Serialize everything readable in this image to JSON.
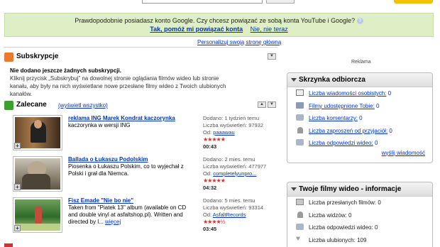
{
  "google_banner": {
    "question": "Prawdopodobnie posiadasz konto Google. Czy chcesz powiązać ze sobą konta YouTube i Google?",
    "help_icon": "question-icon",
    "yes_link": "Tak, pomóż mi powiązać konta",
    "no_link": "Nie, nie teraz"
  },
  "personalize_link": "Personalizuj swoją stronę główną",
  "subscriptions": {
    "title": "Subskrypcje",
    "empty_title": "Nie dodano jeszcze żadnych subskrypcji.",
    "empty_desc": "Kliknij przycisk „Subskrybuj” na dowolnej stronie oglądania filmów wideo lub stronie kanału, aby były na nich wyświetlane nowe przesłane filmy wideo z Twoich ulubionych kanałów.",
    "toggle_icon": "collapse-icon"
  },
  "featured": {
    "title": "Zalecane",
    "show_all": "(wyświetl wszystko)",
    "videos": [
      {
        "title": "reklama ING Marek Kondrat kaczorynka",
        "desc": "kaczorynka w wersji ING",
        "more": "",
        "added": "Dodano: 1 tydzień temu",
        "views": "Liczba wyświetleń: 97932",
        "from_label": "Od:",
        "from": "paaawau",
        "stars": "★★★★★",
        "duration": "00:43"
      },
      {
        "title": "Ballada o Łukaszu Podolskim",
        "desc": "Piosenka o Łukaszu Polskim, co to wyjechał z Polski i grał dla Niemca.",
        "more": "",
        "added": "Dodano: 2 mies. temu",
        "views": "Liczba wyświetleń: 477977",
        "from_label": "Od:",
        "from": "completelyunpro...",
        "stars": "★★★★★",
        "duration": "04:32"
      },
      {
        "title": "Fisz Emade \"Nie bo nie\"",
        "desc": "Taken from \"Piatek 13\" album (available on CD and double vinyl at asfaltshop.pl). Written and directed by l...",
        "more": "więcej",
        "added": "Dodano: 5 mies. temu",
        "views": "Liczba wyświetleń: 93314",
        "from_label": "Od:",
        "from": "AsfaltRecords",
        "stars": "★★★★½",
        "duration": "03:45"
      }
    ]
  },
  "ad_label": "Reklama",
  "inbox": {
    "title": "Skrzynka odbiorcza",
    "rows": [
      {
        "label": "Liczba wiadomości osobistych:",
        "value": "0",
        "icon": "envelope-icon"
      },
      {
        "label": "Filmy udostępnione Tobie:",
        "value": "0",
        "icon": "film-icon"
      },
      {
        "label": "Liczba komentarzy:",
        "value": "0",
        "icon": "comment-icon"
      },
      {
        "label": "Liczba zaproszeń od przyjaciół:",
        "value": "0",
        "icon": "person-icon"
      },
      {
        "label": "Liczba odpowiedzi wideo:",
        "value": "0",
        "icon": "video-reply-icon"
      }
    ],
    "more": "wyślij wiadomość"
  },
  "my_videos": {
    "title": "Twoje filmy wideo - informacje",
    "rows": [
      {
        "label": "Liczba przesłanych filmów:",
        "value": "0",
        "icon": "upload-icon"
      },
      {
        "label": "Liczba widzów:",
        "value": "0",
        "icon": "person-icon"
      },
      {
        "label": "Liczba odpowiedzi wideo:",
        "value": "0",
        "icon": "video-reply-icon"
      },
      {
        "label": "Liczba ulubionych:",
        "value": "109",
        "icon": "heart-icon"
      }
    ]
  }
}
